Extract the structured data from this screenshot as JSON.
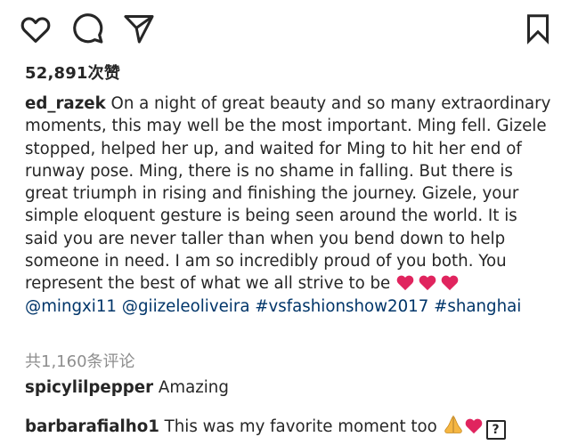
{
  "actions": {
    "like_icon": "heart-outline-icon",
    "comment_icon": "speech-bubble-icon",
    "share_icon": "paper-plane-icon",
    "save_icon": "bookmark-icon"
  },
  "likes": {
    "count_text": "52,891次赞"
  },
  "post": {
    "author": "ed_razek",
    "caption_text": " On a night of great beauty and so many extraordinary moments, this may well be the most important. Ming fell. Gizele stopped, helped her up, and waited for Ming to hit her end of runway pose. Ming, there is no shame in falling. But there is great triumph in rising and finishing the journey. Gizele, your simple eloquent gesture is being seen around the world. It is said you are never taller than when you bend down to help someone in need. I am so incredibly proud of you both. You represent the best of what we all strive to be ",
    "mention_1": "@mingxi11",
    "mention_2": "@giizeleoliveira",
    "hashtag_1": "#vsfashionshow2017",
    "hashtag_2": "#shanghai",
    "heart_color": "#e0245e"
  },
  "comments_summary": {
    "view_all_text": "共1,160条评论"
  },
  "comments": [
    {
      "user": "spicylilpepper",
      "text": " Amazing"
    },
    {
      "user": "barbarafialho1",
      "text": " This was my favorite moment too ",
      "unknown_glyph": "?"
    }
  ],
  "colors": {
    "text": "#262626",
    "link": "#003569",
    "muted": "#8e8e8e"
  }
}
